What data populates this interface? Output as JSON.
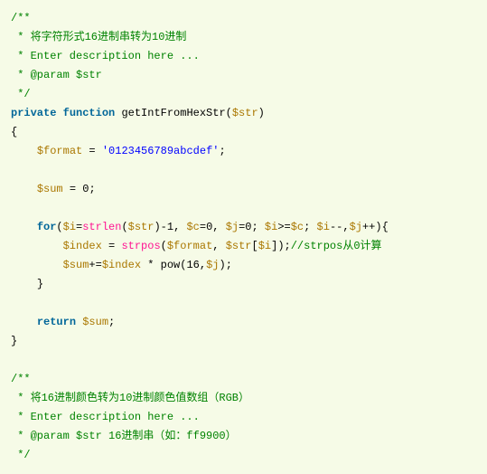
{
  "lines": {
    "c1": "/**",
    "c2": " * 将字符形式16进制串转为10进制",
    "c3": " * Enter description here ...",
    "c4": " * @param $str",
    "c5": " */",
    "kw_private": "private",
    "kw_function": "function",
    "fn_name": "getIntFromHexStr",
    "p_open": "(",
    "p_close": ")",
    "v_str": "$str",
    "brace_open": "{",
    "brace_close": "}",
    "v_format": "$format",
    "eq": " = ",
    "str_format": "'0123456789abcdef'",
    "semi": ";",
    "v_sum": "$sum",
    "num0": "0",
    "kw_for": "for",
    "v_i": "$i",
    "fn_strlen": "strlen",
    "minus1": "-1, ",
    "v_c": "$c",
    "eq0c": "=0, ",
    "v_j": "$j",
    "eq0j": "=0; ",
    "ge": ">=",
    "sep_ij": "; ",
    "idec": "--,",
    "jinc": "++){",
    "v_index": "$index",
    "fn_strpos": "strpos",
    "comma": ", ",
    "br_open": "[",
    "br_close": "]",
    "cmt_strpos": "//strpos从0计算",
    "pluseq": "+=",
    "mul": " * ",
    "fn_pow": "pow",
    "num16": "16",
    "comma2": ",",
    "kw_return": "return",
    "sp": " ",
    "blank": "",
    "c6": "/**",
    "c7": " * 将16进制颜色转为10进制颜色值数组（RGB）",
    "c8": " * Enter description here ...",
    "c9": " * @param $str 16进制串（如：ff9900）",
    "c10": " */"
  }
}
